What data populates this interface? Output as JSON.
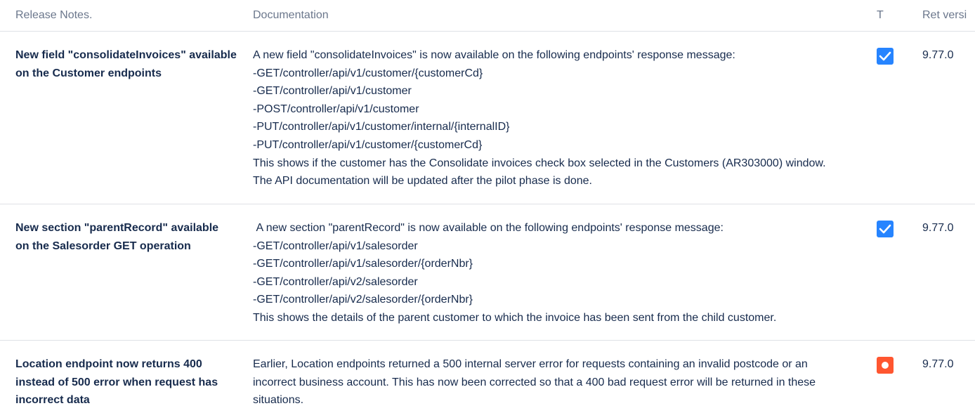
{
  "headers": {
    "release_notes": "Release Notes.",
    "documentation": "Documentation",
    "type": "T",
    "version": "Ret versi"
  },
  "rows": [
    {
      "title": "New field \"consolidateInvoices\" available on the Customer endpoints",
      "doc": [
        "A new field \"consolidateInvoices\" is now available on the following endpoints' response message:",
        "-GET/controller/api/v1/customer/{customerCd}",
        "-GET/controller/api/v1/customer",
        "-POST/controller/api/v1/customer",
        "-PUT/controller/api/v1/customer/internal/{internalID}",
        "-PUT/controller/api/v1/customer/{customerCd}",
        "This shows if the customer has the Consolidate invoices check box selected in the Customers (AR303000) window. The API documentation will be updated after the pilot phase is done."
      ],
      "status_icon": "checkbox-checked-icon",
      "status_color": "#2684ff",
      "version": "9.77.0"
    },
    {
      "title": "New section \"parentRecord\" available on the Salesorder GET operation",
      "doc": [
        " A new section \"parentRecord\" is now available on the following endpoints' response message:",
        "-GET/controller/api/v1/salesorder",
        "-GET/controller/api/v1/salesorder/{orderNbr}",
        "-GET/controller/api/v2/salesorder",
        "-GET/controller/api/v2/salesorder/{orderNbr}",
        "This shows the details of the parent customer to which the invoice has been sent from the child customer."
      ],
      "status_icon": "checkbox-checked-icon",
      "status_color": "#2684ff",
      "version": "9.77.0"
    },
    {
      "title": "Location endpoint now returns 400 instead of 500 error when request has incorrect data",
      "doc": [
        "Earlier, Location endpoints returned a 500 internal server error for requests containing an invalid postcode or an incorrect business account. This has now been corrected so that a 400 bad request error will be returned in these situations."
      ],
      "status_icon": "bug-icon",
      "status_color": "#ff5630",
      "version": "9.77.0"
    }
  ]
}
